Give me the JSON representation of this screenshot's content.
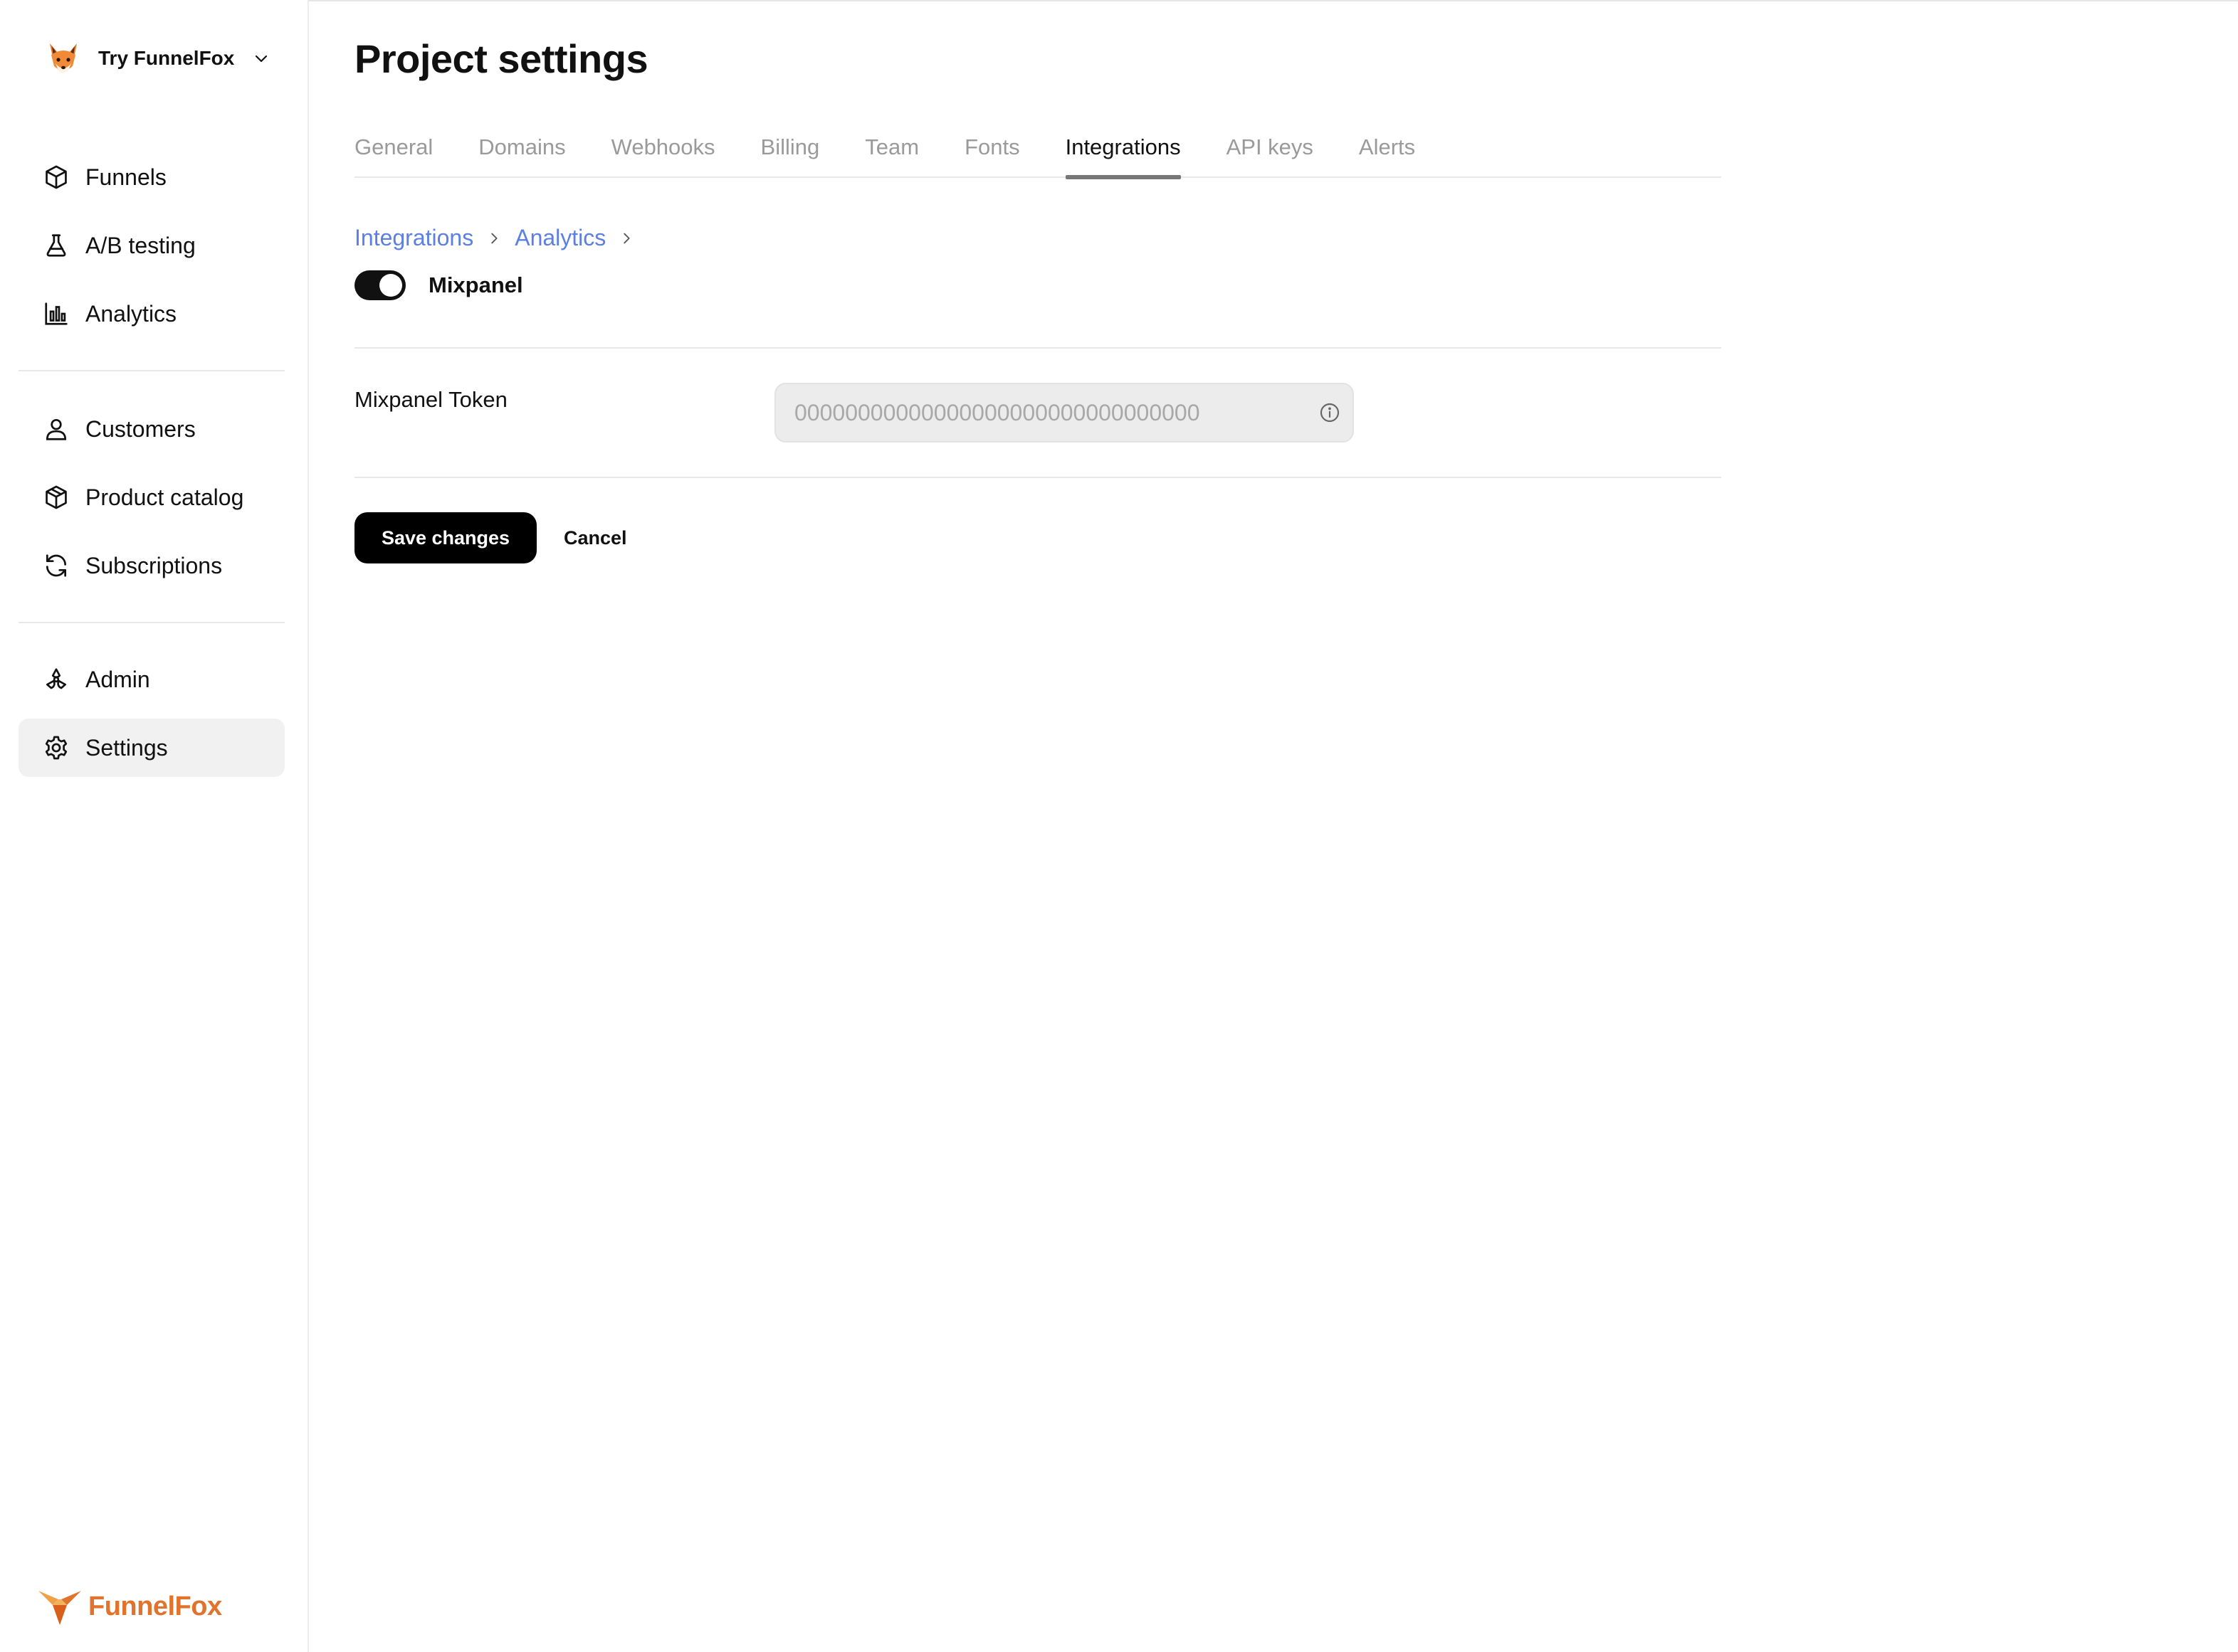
{
  "workspace": {
    "name": "Try FunnelFox",
    "avatar_icon": "fox-emoji-icon"
  },
  "sidebar": {
    "groups": [
      [
        {
          "label": "Funnels",
          "icon": "cube-icon"
        },
        {
          "label": "A/B testing",
          "icon": "flask-icon"
        },
        {
          "label": "Analytics",
          "icon": "bar-chart-icon"
        }
      ],
      [
        {
          "label": "Customers",
          "icon": "user-icon"
        },
        {
          "label": "Product catalog",
          "icon": "box-icon"
        },
        {
          "label": "Subscriptions",
          "icon": "refresh-icon"
        }
      ],
      [
        {
          "label": "Admin",
          "icon": "radiation-icon"
        },
        {
          "label": "Settings",
          "icon": "gear-icon",
          "active": true
        }
      ]
    ]
  },
  "brand": {
    "name": "FunnelFox",
    "color": "#e0742c"
  },
  "page": {
    "title": "Project settings"
  },
  "tabs": [
    {
      "label": "General"
    },
    {
      "label": "Domains"
    },
    {
      "label": "Webhooks"
    },
    {
      "label": "Billing"
    },
    {
      "label": "Team"
    },
    {
      "label": "Fonts"
    },
    {
      "label": "Integrations",
      "active": true
    },
    {
      "label": "API keys"
    },
    {
      "label": "Alerts"
    }
  ],
  "breadcrumb": {
    "items": [
      "Integrations",
      "Analytics"
    ],
    "link_color": "#5b7fe3"
  },
  "integration": {
    "name": "Mixpanel",
    "enabled": true
  },
  "form": {
    "token_label": "Mixpanel Token",
    "token_value": "",
    "token_placeholder": "00000000000000000000000000000000"
  },
  "actions": {
    "save_label": "Save changes",
    "cancel_label": "Cancel"
  }
}
